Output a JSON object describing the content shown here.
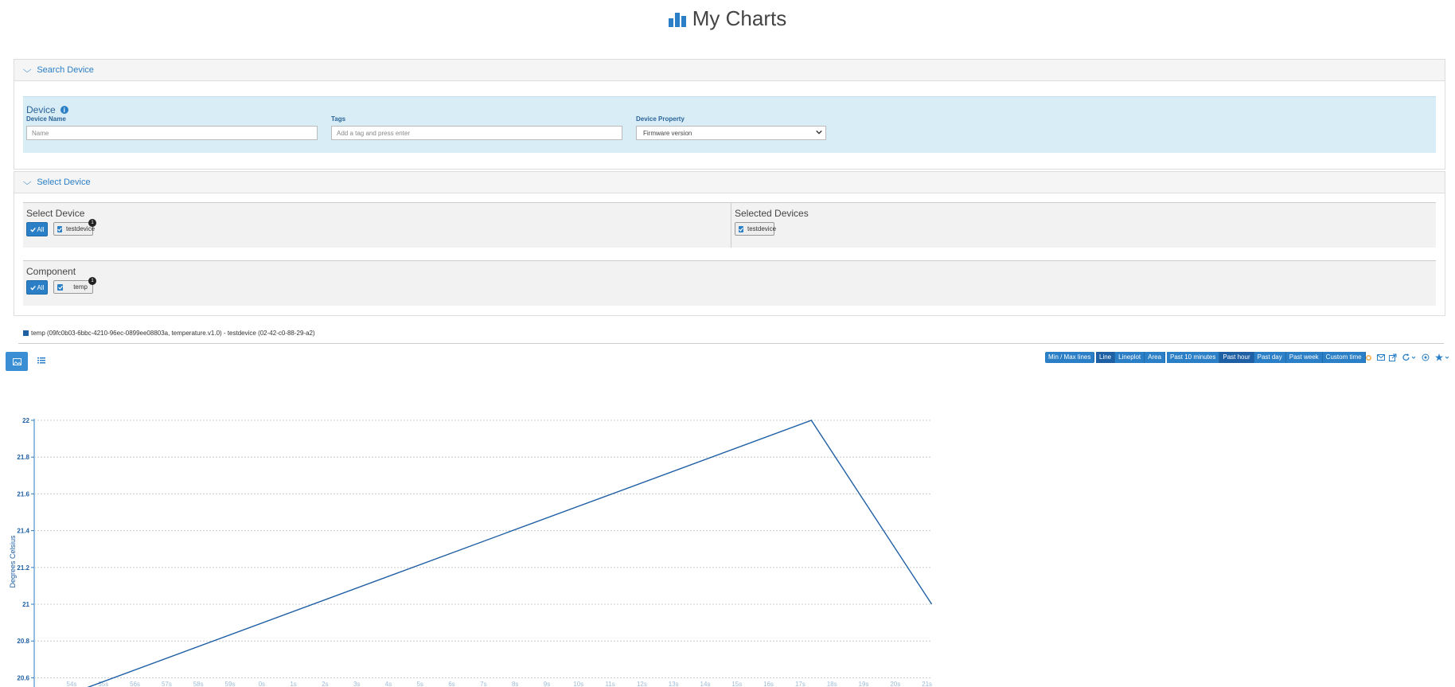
{
  "header": {
    "title": "My Charts"
  },
  "search_panel": {
    "title": "Search Device",
    "device_heading": "Device",
    "device_name_label": "Device Name",
    "device_name_placeholder": "Name",
    "tags_label": "Tags",
    "tags_placeholder": "Add a tag and press enter",
    "device_property_label": "Device Property",
    "device_property_value": "Firmware version"
  },
  "select_panel": {
    "title": "Select Device",
    "select_heading": "Select Device",
    "all_label": "All",
    "devices": [
      {
        "name": "testdevice",
        "count": "1"
      }
    ],
    "selected_heading": "Selected Devices",
    "selected_devices": [
      {
        "name": "testdevice"
      }
    ],
    "component_heading": "Component",
    "components": [
      {
        "name": "temp",
        "count": "1"
      }
    ]
  },
  "legend": {
    "text": "temp (09fc0b03-6bbc-4210-96ec-0899ee08803a, temperature.v1.0) - testdevice (02-42-c0-88-29-a2)"
  },
  "toolbar": {
    "minmax": "Min / Max lines",
    "chart_types": [
      "Line",
      "Lineplot",
      "Area"
    ],
    "active_chart_type": "Line",
    "time_ranges": [
      "Past 10 minutes",
      "Past hour",
      "Past day",
      "Past week",
      "Custom time"
    ],
    "active_time_range": "Past hour"
  },
  "colors": {
    "accent": "#2a7fc6",
    "line": "#1f5fa4",
    "info_bg": "#d9edf7"
  },
  "chart_data": {
    "type": "line",
    "ylabel": "Degrees Celsius",
    "xlabel": "",
    "yticks": [
      "20.6",
      "20.8",
      "21",
      "21.2",
      "21.4",
      "21.6",
      "21.8",
      "22"
    ],
    "xticks": [
      "54s",
      "55s",
      "56s",
      "57s",
      "58s",
      "59s",
      "0s",
      "1s",
      "2s",
      "3s",
      "4s",
      "5s",
      "6s",
      "7s",
      "8s",
      "9s",
      "10s",
      "11s",
      "12s",
      "13s",
      "14s",
      "15s",
      "16s",
      "17s",
      "18s",
      "19s",
      "20s",
      "21s"
    ],
    "ylim": [
      20.55,
      22
    ],
    "grid": true,
    "series": [
      {
        "x": [
          53.75,
          17.35,
          21.15
        ],
        "y": [
          20.5,
          22,
          21
        ]
      }
    ]
  }
}
